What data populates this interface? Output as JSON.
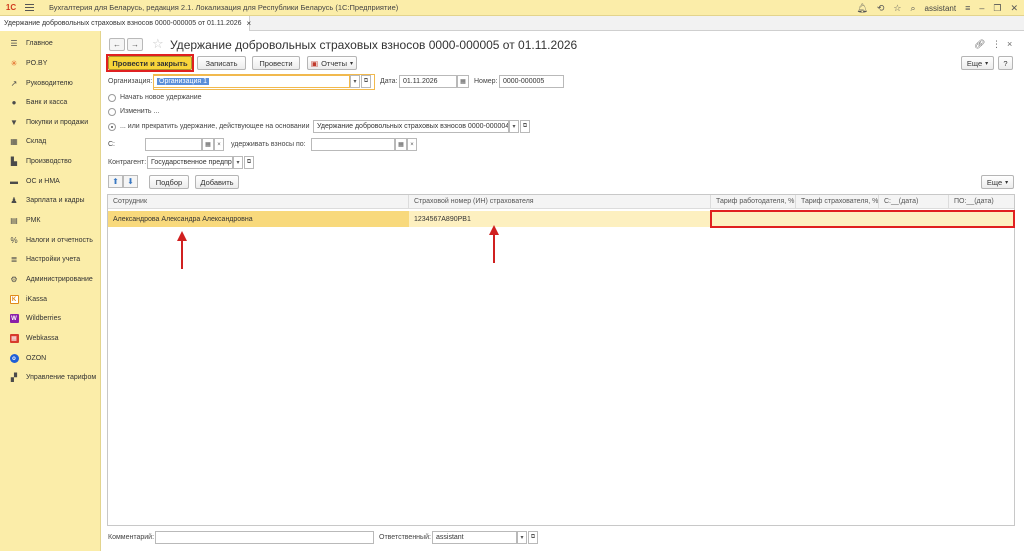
{
  "app": {
    "logo": "1С",
    "title": "Бухгалтерия для Беларусь, редакция 2.1. Локализация для Республики Беларусь   (1С:Предприятие)",
    "user": "assistant",
    "tab_title": "Удержание добровольных страховых взносов 0000-000005 от 01.11.2026"
  },
  "sidebar": {
    "items": [
      {
        "label": "Главное",
        "icon": "menu-lines-icon"
      },
      {
        "label": "PO.BY",
        "icon": "sun-icon"
      },
      {
        "label": "Руководителю",
        "icon": "trend-icon"
      },
      {
        "label": "Банк и касса",
        "icon": "coin-icon"
      },
      {
        "label": "Покупки и продажи",
        "icon": "cart-icon"
      },
      {
        "label": "Склад",
        "icon": "warehouse-icon"
      },
      {
        "label": "Производство",
        "icon": "factory-icon"
      },
      {
        "label": "ОС и НМА",
        "icon": "truck-icon"
      },
      {
        "label": "Зарплата и кадры",
        "icon": "person-icon"
      },
      {
        "label": "РМК",
        "icon": "register-icon"
      },
      {
        "label": "Налоги и отчетность",
        "icon": "percent-icon"
      },
      {
        "label": "Настройки учета",
        "icon": "settings-list-icon"
      },
      {
        "label": "Администрирование",
        "icon": "gear-icon"
      },
      {
        "label": "iKassa",
        "icon": "ikassa-icon"
      },
      {
        "label": "Wildberries",
        "icon": "wildberries-icon"
      },
      {
        "label": "Webkassa",
        "icon": "webkassa-icon"
      },
      {
        "label": "OZON",
        "icon": "ozon-icon"
      },
      {
        "label": "Управление тарифом",
        "icon": "grid-icon"
      }
    ]
  },
  "document": {
    "title": "Удержание добровольных страховых взносов 0000-000005 от 01.11.2026",
    "buttons": {
      "post_close": "Провести и закрыть",
      "save": "Записать",
      "post": "Провести",
      "reports": "Отчеты",
      "more": "Еще",
      "help": "?",
      "select": "Подбор",
      "add": "Добавить"
    },
    "fields": {
      "org_label": "Организация:",
      "org_value": "Организация 1",
      "date_label": "Дата:",
      "date_value": "01.11.2026",
      "number_label": "Номер:",
      "number_value": "0000-000005",
      "radio_new": "Начать новое удержание",
      "radio_change": "Изменить ...",
      "radio_stop": "... или прекратить удержание, действующее на основании",
      "basis_value": "Удержание добровольных страховых взносов 0000-000004 о",
      "from_label": "С:",
      "from_value": "",
      "until_label": "удерживать взносы по:",
      "until_value": "",
      "counterparty_label": "Контрагент:",
      "counterparty_value": "Государственное предпр",
      "comment_label": "Комментарий:",
      "comment_value": "",
      "responsible_label": "Ответственный:",
      "responsible_value": "assistant"
    },
    "table": {
      "columns": [
        "Сотрудник",
        "Страховой номер (ИН) страхователя",
        "Тариф работодателя, %",
        "Тариф страхователя, %",
        "С:__(дата)",
        "ПО:__(дата)"
      ],
      "rows": [
        {
          "employee": "Александрова Александра Александровна",
          "insurance_no": "1234567A890PB1",
          "employer_rate": "",
          "insurer_rate": "",
          "from": "",
          "to": ""
        }
      ]
    }
  },
  "colors": {
    "sidebar_bg": "#fbeda9",
    "primary_button": "#f8d53a",
    "highlight": "#e02020",
    "selected_row": "#fdf0c0"
  }
}
